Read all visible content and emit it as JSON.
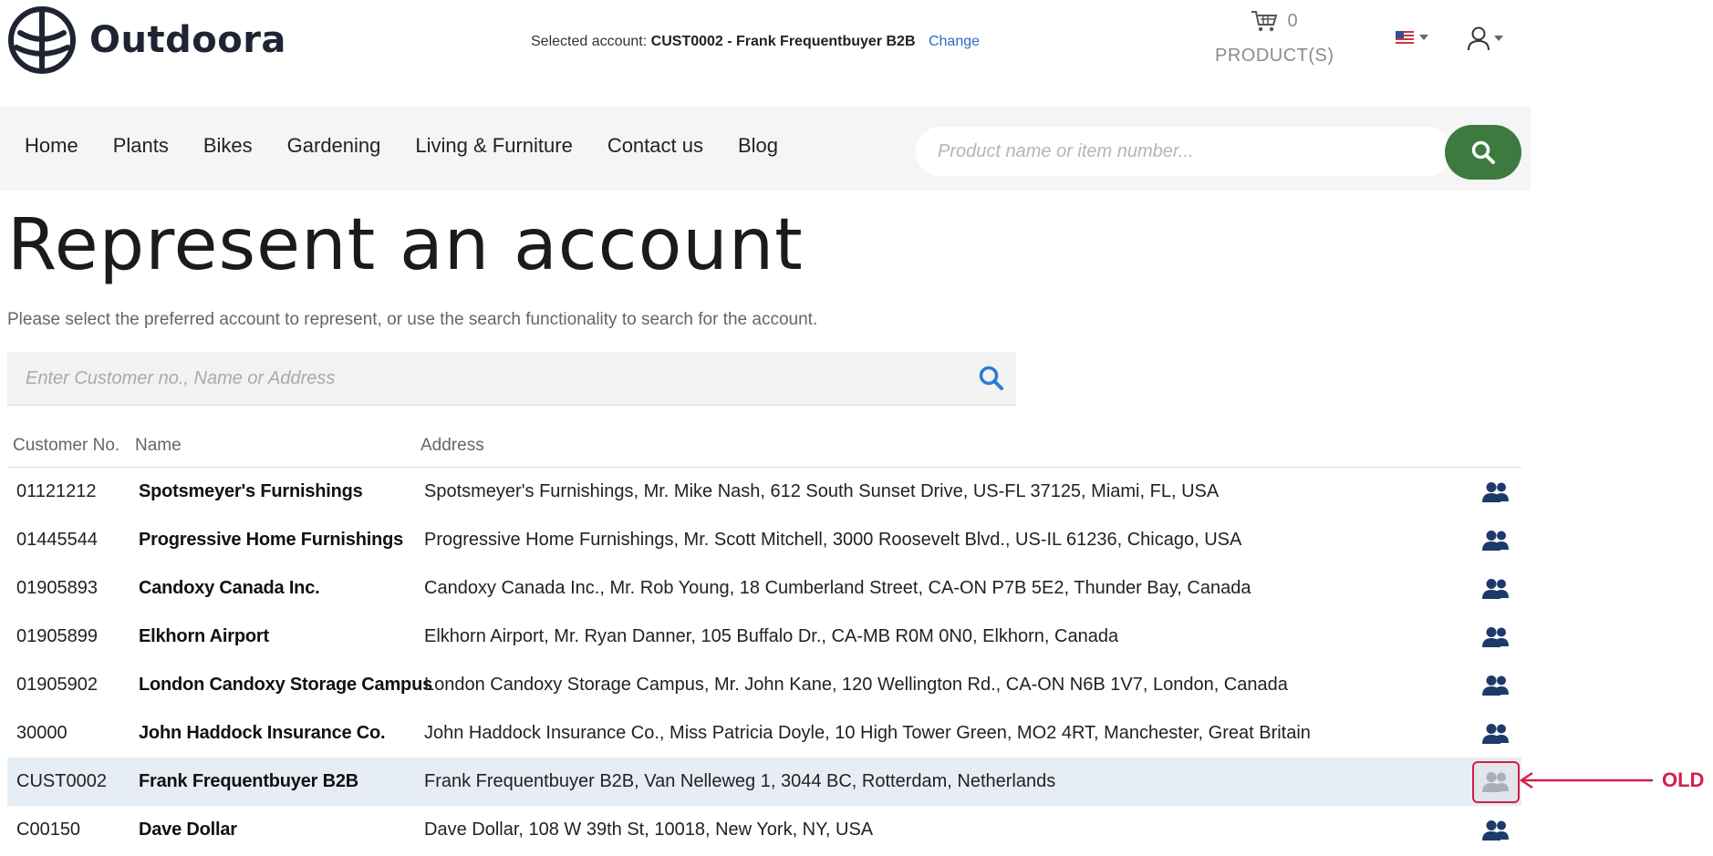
{
  "brand": {
    "name": "Outdoora"
  },
  "header": {
    "selected_account_label": "Selected account:",
    "selected_account_value": "CUST0002 - Frank Frequentbuyer B2B",
    "change_label": "Change",
    "cart_count": "0",
    "cart_label": "PRODUCT(S)",
    "cart_icon": "cart-icon",
    "language_icon": "us-flag-icon",
    "user_icon": "user-icon"
  },
  "nav": {
    "items": [
      "Home",
      "Plants",
      "Bikes",
      "Gardening",
      "Living & Furniture",
      "Contact us",
      "Blog"
    ],
    "search_placeholder": "Product name or item number...",
    "search_icon": "search-icon"
  },
  "main": {
    "title": "Represent an account",
    "intro": "Please select the preferred account to represent, or use the search functionality to search for the account.",
    "search_placeholder": "Enter Customer no., Name or Address",
    "columns": {
      "customer_no": "Customer No.",
      "name": "Name",
      "address": "Address"
    },
    "rows": [
      {
        "no": "01121212",
        "name": "Spotsmeyer's Furnishings",
        "address": "Spotsmeyer's Furnishings, Mr. Mike Nash, 612 South Sunset Drive, US-FL 37125, Miami, FL, USA"
      },
      {
        "no": "01445544",
        "name": "Progressive Home Furnishings",
        "address": "Progressive Home Furnishings, Mr. Scott Mitchell, 3000 Roosevelt Blvd., US-IL 61236, Chicago, USA"
      },
      {
        "no": "01905893",
        "name": "Candoxy Canada Inc.",
        "address": "Candoxy Canada Inc., Mr. Rob Young, 18 Cumberland Street, CA-ON P7B 5E2, Thunder Bay, Canada"
      },
      {
        "no": "01905899",
        "name": "Elkhorn Airport",
        "address": "Elkhorn Airport, Mr. Ryan Danner, 105 Buffalo Dr., CA-MB R0M 0N0, Elkhorn, Canada"
      },
      {
        "no": "01905902",
        "name": "London Candoxy Storage Campus",
        "address": "London Candoxy Storage Campus, Mr. John Kane, 120 Wellington Rd., CA-ON N6B 1V7, London, Canada"
      },
      {
        "no": "30000",
        "name": "John Haddock Insurance Co.",
        "address": "John Haddock Insurance Co., Miss Patricia Doyle, 10 High Tower Green, MO2 4RT, Manchester, Great Britain"
      },
      {
        "no": "CUST0002",
        "name": "Frank Frequentbuyer B2B",
        "address": "Frank Frequentbuyer B2B, Van Nelleweg 1, 3044 BC, Rotterdam, Netherlands",
        "selected": true
      },
      {
        "no": "C00150",
        "name": "Dave Dollar",
        "address": "Dave Dollar, 108 W 39th St, 10018, New York, NY, USA"
      }
    ],
    "row_action_icon": "users-icon"
  },
  "annotation": {
    "label": "OLD",
    "color": "#d21f4a"
  },
  "colors": {
    "accent_green": "#3d7a3f",
    "link_blue": "#2a6cc4",
    "icon_navy": "#1e3a6b",
    "selected_row": "#e7edf4"
  }
}
